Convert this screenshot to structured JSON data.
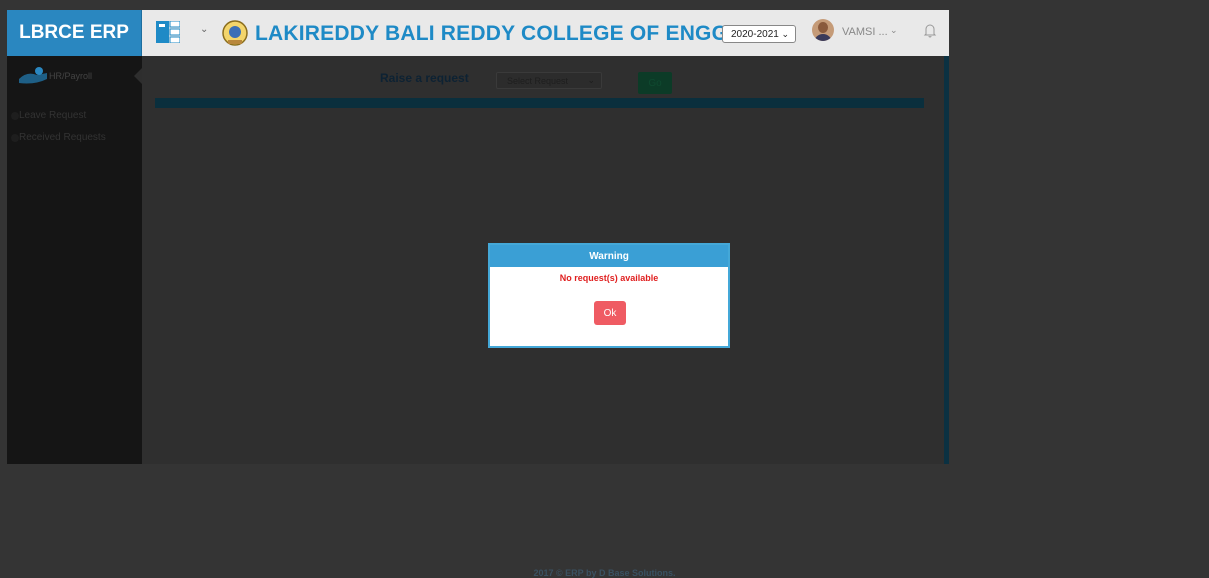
{
  "brand": {
    "title": "LBRCE ERP"
  },
  "header": {
    "college_name": "LAKIREDDY BALI REDDY COLLEGE OF ENGG",
    "academic_year": "2020-2021",
    "user_name": "VAMSI ..."
  },
  "sidebar": {
    "module_label": "HR/Payroll",
    "items": [
      {
        "label": "Leave Request"
      },
      {
        "label": "Received Requests"
      }
    ]
  },
  "main": {
    "raise_label": "Raise a request",
    "request_select_value": "Select Request",
    "go_label": "Go"
  },
  "modal": {
    "title": "Warning",
    "message": "No request(s) available",
    "ok_label": "Ok"
  },
  "footer": {
    "text": "2017 © ERP by D Base Solutions."
  },
  "colors": {
    "brand_blue": "#2a87c0",
    "college_text": "#1e8ac6",
    "modal_header": "#3a9fd5",
    "error_red": "#e01f1f",
    "ok_button": "#ef5b63"
  },
  "icons": [
    "modules-grid-icon",
    "college-logo-icon",
    "user-avatar",
    "bell-icon",
    "hr-payroll-hand-icon"
  ]
}
